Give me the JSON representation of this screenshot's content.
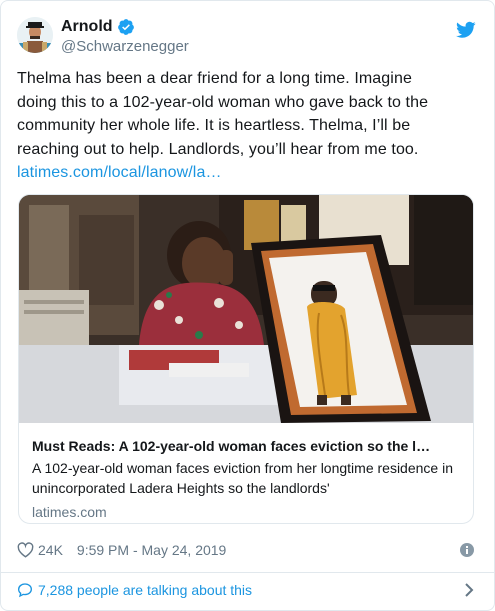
{
  "author": {
    "display_name": "Arnold",
    "handle": "@Schwarzenegger",
    "verified": true,
    "avatar": "avatar-portrait",
    "brand_icon": "twitter-bird-icon"
  },
  "tweet": {
    "lines": [
      "Thelma has been a dear friend for a long time. Imagine",
      "doing this to a 102-year-old woman who gave back to the",
      "community her whole life. It is heartless. Thelma, I’ll be",
      "reaching out to help. Landlords, you’ll hear from me too."
    ],
    "link": "latimes.com/local/lanow/la…"
  },
  "card": {
    "image": "photo-elderly-woman-with-framed-portrait",
    "title": "Must Reads: A 102-year-old woman faces eviction so the l…",
    "description": "A 102-year-old woman faces eviction from her longtime residence in unincorporated Ladera Heights so the landlords'",
    "domain": "latimes.com"
  },
  "meta": {
    "likes": "24K",
    "timestamp": "9:59 PM - May 24, 2019"
  },
  "footer": {
    "conversation": "7,288 people are talking about this"
  },
  "colors": {
    "link": "#1b95e0",
    "secondary_text": "#657786",
    "border": "#e1e8ed",
    "verified_badge": "#1da1f2"
  }
}
